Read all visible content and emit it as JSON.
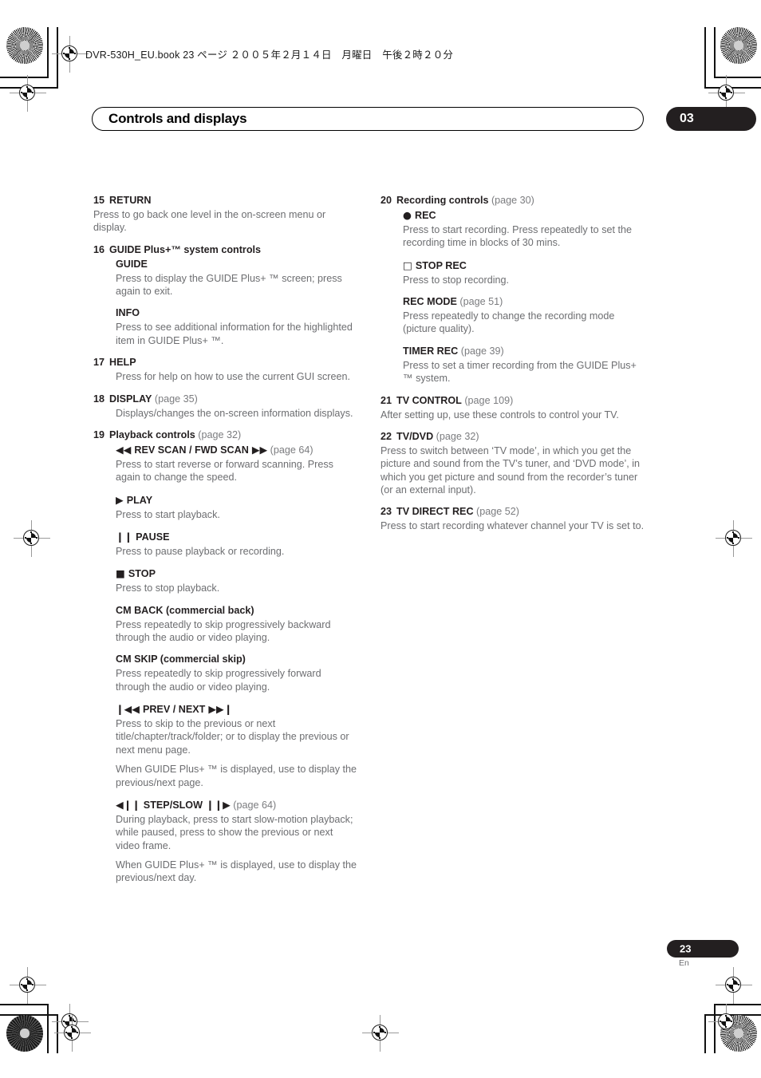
{
  "slug": "DVR-530H_EU.book  23 ページ  ２００５年２月１４日　月曜日　午後２時２０分",
  "header": {
    "chapter_title": "Controls and displays",
    "chapter_number": "03"
  },
  "footer": {
    "page_number": "23",
    "language": "En"
  },
  "colors": {
    "chapter_tab": "#231f20",
    "body_text": "#6d6e71",
    "heading_text": "#231f20",
    "page_ref": "#7b7c7f"
  },
  "left_column": [
    {
      "number": "15",
      "label": "RETURN",
      "ref": "",
      "body": [
        "Press to go back one level in the on-screen menu or display."
      ],
      "body_indent": false,
      "subs": []
    },
    {
      "number": "16",
      "label": "GUIDE Plus+™ system controls",
      "ref": "",
      "body": [],
      "body_indent": true,
      "subs": [
        {
          "glyph": "",
          "label": "GUIDE",
          "ref": "",
          "body": [
            "Press to display the GUIDE Plus+ ™ screen; press again to exit."
          ]
        },
        {
          "glyph": "",
          "label": "INFO",
          "ref": "",
          "body": [
            "Press to see additional information for the highlighted item in GUIDE Plus+ ™."
          ]
        }
      ]
    },
    {
      "number": "17",
      "label": "HELP",
      "ref": "",
      "body": [
        "Press for help on how to use the current GUI screen."
      ],
      "body_indent": true,
      "subs": []
    },
    {
      "number": "18",
      "label": "DISPLAY",
      "ref": "(page 35)",
      "body": [
        "Displays/changes the on-screen information displays."
      ],
      "body_indent": true,
      "subs": []
    },
    {
      "number": "19",
      "label": "Playback controls",
      "ref": "(page 32)",
      "body": [],
      "body_indent": true,
      "subs": [
        {
          "glyph": "◀◀",
          "label": "REV SCAN / FWD SCAN",
          "glyph_after": "▶▶",
          "ref": "(page 64)",
          "body": [
            "Press to start reverse or forward scanning. Press again to change the speed."
          ]
        },
        {
          "glyph": "▶",
          "label": "PLAY",
          "ref": "",
          "body": [
            "Press to start playback."
          ]
        },
        {
          "glyph": "❙❙",
          "label": "PAUSE",
          "ref": "",
          "body": [
            "Press to pause playback or recording."
          ]
        },
        {
          "glyph": "■",
          "label": "STOP",
          "ref": "",
          "body": [
            "Press to stop playback."
          ]
        },
        {
          "glyph": "",
          "label": "CM BACK (commercial back)",
          "ref": "",
          "body": [
            "Press repeatedly to skip progressively backward through the audio or video playing."
          ]
        },
        {
          "glyph": "",
          "label": "CM SKIP (commercial skip)",
          "ref": "",
          "body": [
            "Press repeatedly to skip progressively forward through the audio or video playing."
          ]
        },
        {
          "glyph": "❙◀◀",
          "label": "PREV / NEXT",
          "glyph_after": "▶▶❙",
          "ref": "",
          "body": [
            "Press to skip to the previous or next title/chapter/track/folder; or to display the previous or next menu page.",
            "When GUIDE Plus+ ™ is displayed, use to display the previous/next page."
          ]
        },
        {
          "glyph": "◀❙❙",
          "label": "STEP/SLOW",
          "glyph_after": "❙❙▶",
          "ref": "(page 64)",
          "body": [
            "During playback, press to start slow-motion playback; while paused, press to show the previous or next video frame.",
            "When GUIDE Plus+ ™ is displayed, use to display the previous/next day."
          ]
        }
      ]
    }
  ],
  "right_column": [
    {
      "number": "20",
      "label": "Recording controls",
      "ref": "(page 30)",
      "body": [],
      "body_indent": true,
      "subs": [
        {
          "glyph": "●",
          "label": "REC",
          "ref": "",
          "body": [
            "Press to start recording. Press repeatedly to set the recording time in blocks of 30 mins."
          ]
        },
        {
          "glyph": "□",
          "label": "STOP REC",
          "ref": "",
          "body": [
            "Press to stop recording."
          ]
        },
        {
          "glyph": "",
          "label": "REC MODE",
          "ref": "(page 51)",
          "body": [
            "Press repeatedly to change the recording mode (picture quality)."
          ]
        },
        {
          "glyph": "",
          "label": "TIMER REC",
          "ref": "(page 39)",
          "body": [
            "Press to set a timer recording from the GUIDE Plus+ ™ system."
          ]
        }
      ]
    },
    {
      "number": "21",
      "label": "TV CONTROL",
      "ref": "(page 109)",
      "body": [
        "After setting up, use these controls to control your TV."
      ],
      "body_indent": false,
      "subs": []
    },
    {
      "number": "22",
      "label": "TV/DVD",
      "ref": "(page 32)",
      "body": [
        "Press to switch between ‘TV mode’, in which you get the picture and sound from the TV’s tuner, and ‘DVD mode’, in which you get picture and sound from the recorder’s tuner (or an external input)."
      ],
      "body_indent": false,
      "subs": []
    },
    {
      "number": "23",
      "label": "TV DIRECT REC",
      "ref": "(page 52)",
      "body": [
        "Press to start recording whatever channel your TV is set to."
      ],
      "body_indent": false,
      "subs": []
    }
  ]
}
